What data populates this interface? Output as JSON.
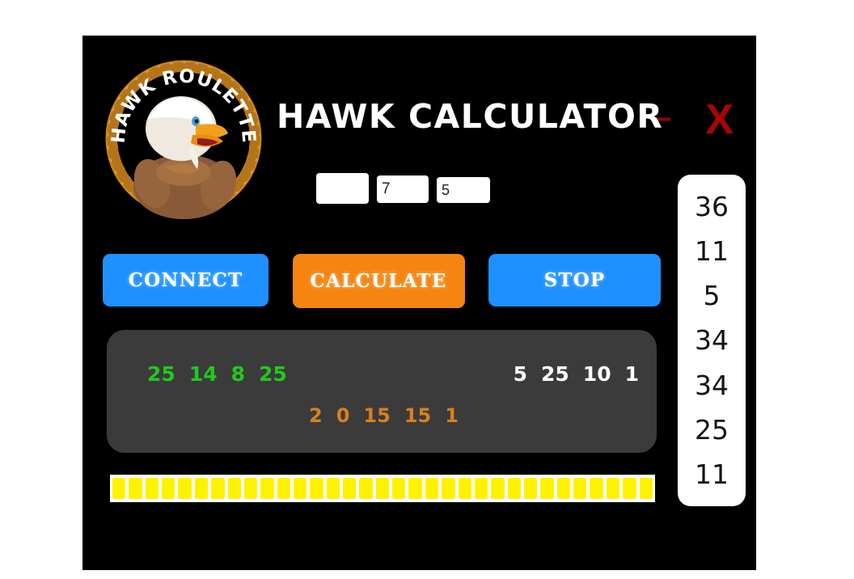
{
  "window": {
    "title": "HAWK CALCULATOR",
    "background_color": "#000000",
    "controls": {
      "minimize_label": "–",
      "close_label": "X",
      "control_color": "#9c0000"
    }
  },
  "logo": {
    "name": "hawk-roulette-logo",
    "arc_text": "HAWK ROULETTE",
    "rope_color": "#f0a824",
    "mascot": "eagle"
  },
  "inputs": [
    {
      "name": "input-a",
      "value": "",
      "placeholder": ""
    },
    {
      "name": "input-b",
      "value": "7",
      "placeholder": ""
    },
    {
      "name": "input-c",
      "value": "5",
      "placeholder": ""
    }
  ],
  "buttons": {
    "connect": {
      "label": "CONNECT",
      "color": "#1e90ff"
    },
    "calculate": {
      "label": "CALCULATE",
      "color": "#f58410"
    },
    "stop": {
      "label": "STOP",
      "color": "#1e90ff"
    }
  },
  "results": {
    "panel_color": "#3b3b3b",
    "green": {
      "color": "#22c81e",
      "values": [
        "25",
        "14",
        "8",
        "25"
      ]
    },
    "white": {
      "color": "#ffffff",
      "values": [
        "5",
        "25",
        "10",
        "1"
      ]
    },
    "orange": {
      "color": "#d6811f",
      "values": [
        "2",
        "0",
        "15",
        "15",
        "1"
      ]
    }
  },
  "progress": {
    "color": "#fff200",
    "segments": 33,
    "percent": 100
  },
  "history": {
    "values": [
      "36",
      "11",
      "5",
      "34",
      "34",
      "25",
      "11"
    ]
  }
}
